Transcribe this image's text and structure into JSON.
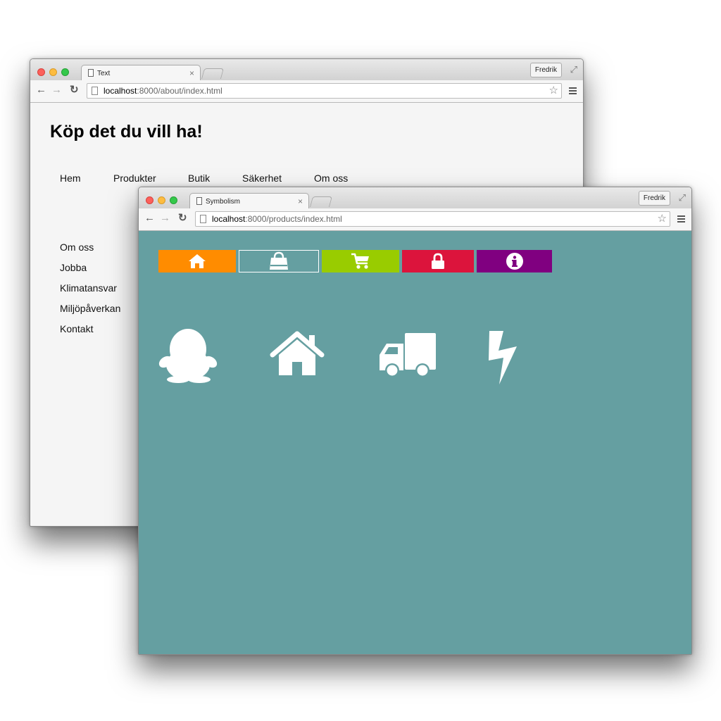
{
  "back_window": {
    "tab_title": "Text",
    "tab_close": "×",
    "user_button": "Fredrik",
    "fullscreen_glyph": "⤢",
    "nav": {
      "back": "←",
      "forward": "→",
      "reload": "↻"
    },
    "url_host": "localhost",
    "url_path": ":8000/about/index.html",
    "bookmark_glyph": "☆",
    "page_heading": "Köp det du vill ha!",
    "top_nav": [
      "Hem",
      "Produkter",
      "Butik",
      "Säkerhet",
      "Om oss"
    ],
    "sub_nav": [
      "Om oss",
      "Jobba",
      "Klimatansvar",
      "Miljöpåverkan",
      "Kontakt"
    ]
  },
  "front_window": {
    "tab_title": "Symbolism",
    "tab_close": "×",
    "user_button": "Fredrik",
    "fullscreen_glyph": "⤢",
    "nav": {
      "back": "←",
      "forward": "→",
      "reload": "↻"
    },
    "url_host": "localhost",
    "url_path": ":8000/products/index.html",
    "bookmark_glyph": "☆",
    "background_color": "#659fa1",
    "nav_tiles": [
      {
        "icon": "home-icon",
        "color": "#ff8c00",
        "selected": false
      },
      {
        "icon": "shopping-bag-icon",
        "color": "#659fa1",
        "selected": true
      },
      {
        "icon": "shopping-cart-icon",
        "color": "#99cc00",
        "selected": false
      },
      {
        "icon": "lock-icon",
        "color": "#dc143c",
        "selected": false
      },
      {
        "icon": "info-icon",
        "color": "#800080",
        "selected": false
      }
    ],
    "large_icons": [
      "penguin-icon",
      "home-icon",
      "truck-icon",
      "lightning-icon"
    ]
  }
}
